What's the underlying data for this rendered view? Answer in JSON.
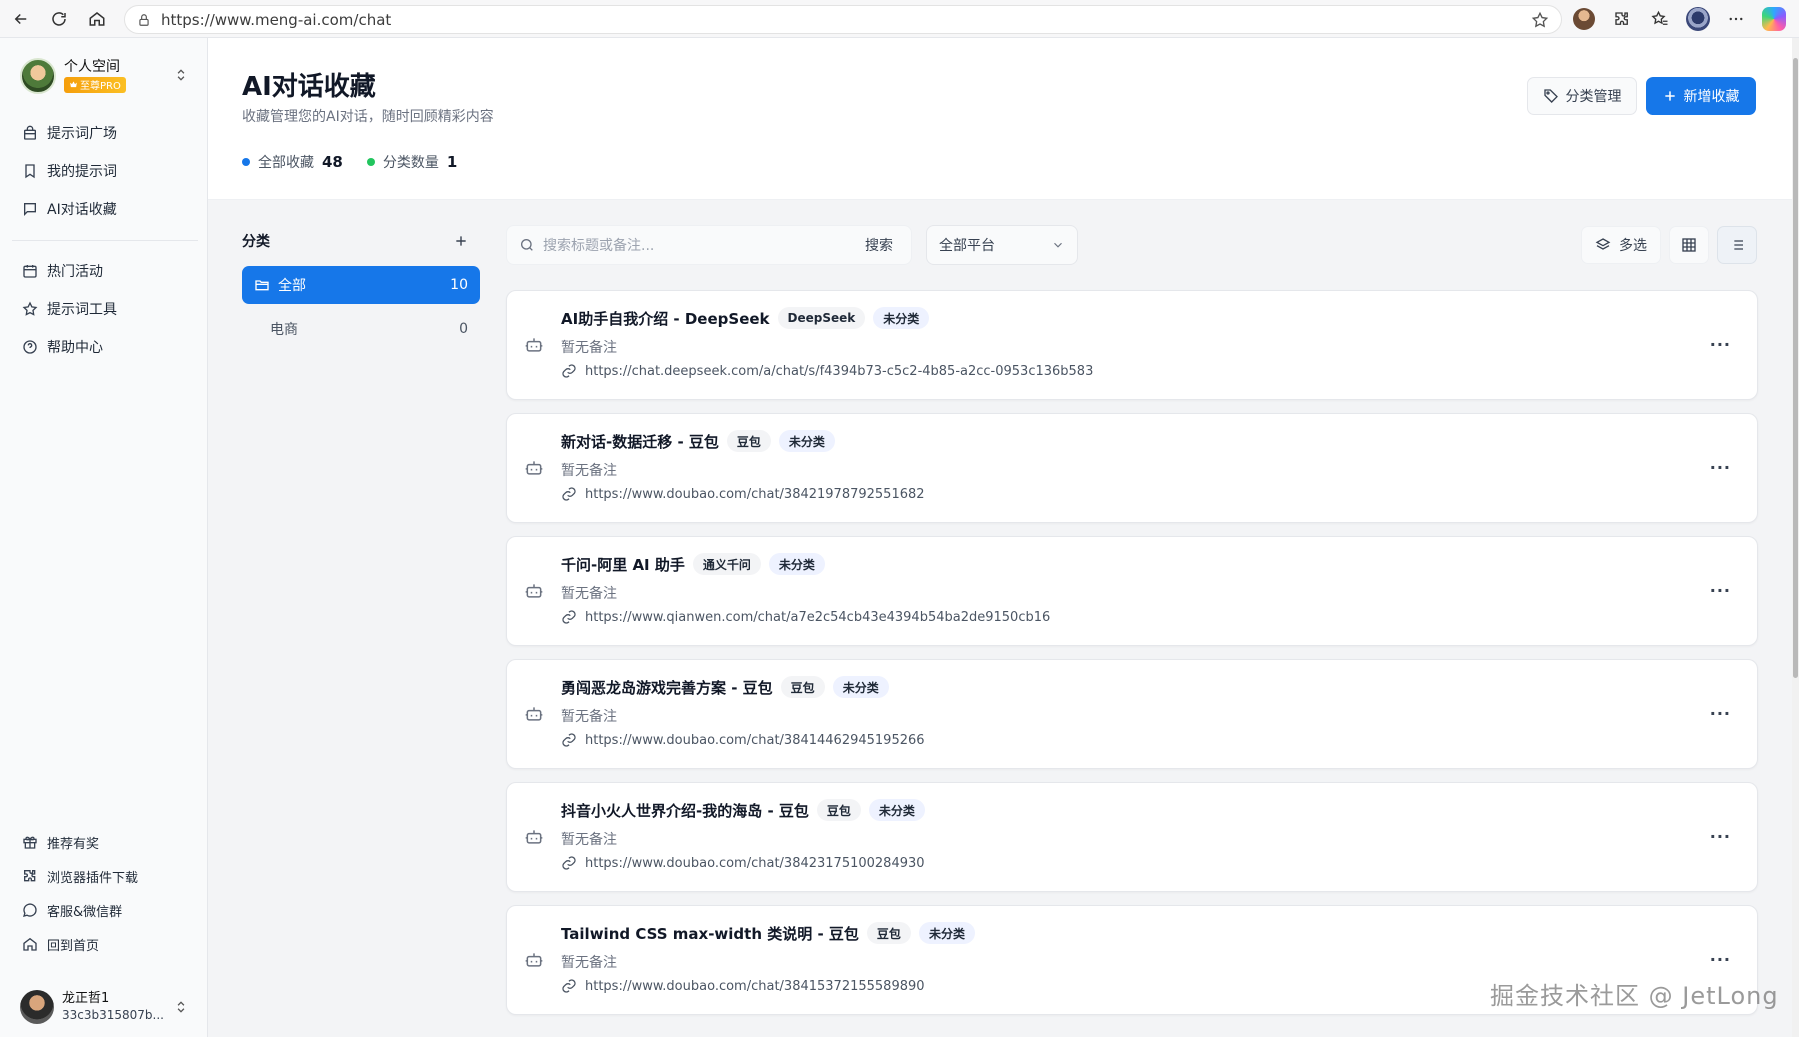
{
  "browser": {
    "url": "https://www.meng-ai.com/chat"
  },
  "sidebar": {
    "space_name": "个人空间",
    "pro_badge": "至尊PRO",
    "menu_primary": [
      {
        "label": "提示词广场",
        "icon": "shopping-bag-icon"
      },
      {
        "label": "我的提示词",
        "icon": "bookmark-icon"
      },
      {
        "label": "AI对话收藏",
        "icon": "chat-bubble-icon"
      }
    ],
    "menu_secondary": [
      {
        "label": "热门活动",
        "icon": "calendar-icon"
      },
      {
        "label": "提示词工具",
        "icon": "star-icon"
      },
      {
        "label": "帮助中心",
        "icon": "help-circle-icon"
      }
    ],
    "menu_bottom": [
      {
        "label": "推荐有奖",
        "icon": "gift-icon"
      },
      {
        "label": "浏览器插件下载",
        "icon": "puzzle-icon"
      },
      {
        "label": "客服&微信群",
        "icon": "message-circle-icon"
      },
      {
        "label": "回到首页",
        "icon": "home-icon"
      }
    ],
    "user": {
      "name": "龙正哲1",
      "id": "33c3b315807b..."
    }
  },
  "header": {
    "title": "AI对话收藏",
    "subtitle": "收藏管理您的AI对话，随时回顾精彩内容",
    "stats": [
      {
        "label": "全部收藏",
        "value": "48",
        "color": "#1677e9"
      },
      {
        "label": "分类数量",
        "value": "1",
        "color": "#22c55e"
      }
    ],
    "manage_button": "分类管理",
    "new_button": "新增收藏"
  },
  "categories": {
    "title": "分类",
    "items": [
      {
        "label": "全部",
        "count": "10",
        "active": true
      },
      {
        "label": "电商",
        "count": "0",
        "active": false
      }
    ]
  },
  "toolbar": {
    "search_placeholder": "搜索标题或备注...",
    "search_button": "搜索",
    "platform_select": "全部平台",
    "multi_select": "多选"
  },
  "cards": [
    {
      "title": "AI助手自我介绍 - DeepSeek",
      "platform": "DeepSeek",
      "category": "未分类",
      "note": "暂无备注",
      "url": "https://chat.deepseek.com/a/chat/s/f4394b73-c5c2-4b85-a2cc-0953c136b583"
    },
    {
      "title": "新对话-数据迁移 - 豆包",
      "platform": "豆包",
      "category": "未分类",
      "note": "暂无备注",
      "url": "https://www.doubao.com/chat/38421978792551682"
    },
    {
      "title": "千问-阿里 AI 助手",
      "platform": "通义千问",
      "category": "未分类",
      "note": "暂无备注",
      "url": "https://www.qianwen.com/chat/a7e2c54cb43e4394b54ba2de9150cb16"
    },
    {
      "title": "勇闯恶龙岛游戏完善方案 - 豆包",
      "platform": "豆包",
      "category": "未分类",
      "note": "暂无备注",
      "url": "https://www.doubao.com/chat/38414462945195266"
    },
    {
      "title": "抖音小火人世界介绍-我的海岛 - 豆包",
      "platform": "豆包",
      "category": "未分类",
      "note": "暂无备注",
      "url": "https://www.doubao.com/chat/38423175100284930"
    },
    {
      "title": "Tailwind CSS max-width 类说明 - 豆包",
      "platform": "豆包",
      "category": "未分类",
      "note": "暂无备注",
      "url": "https://www.doubao.com/chat/38415372155589890"
    }
  ],
  "watermark": "掘金技术社区 @ JetLong"
}
